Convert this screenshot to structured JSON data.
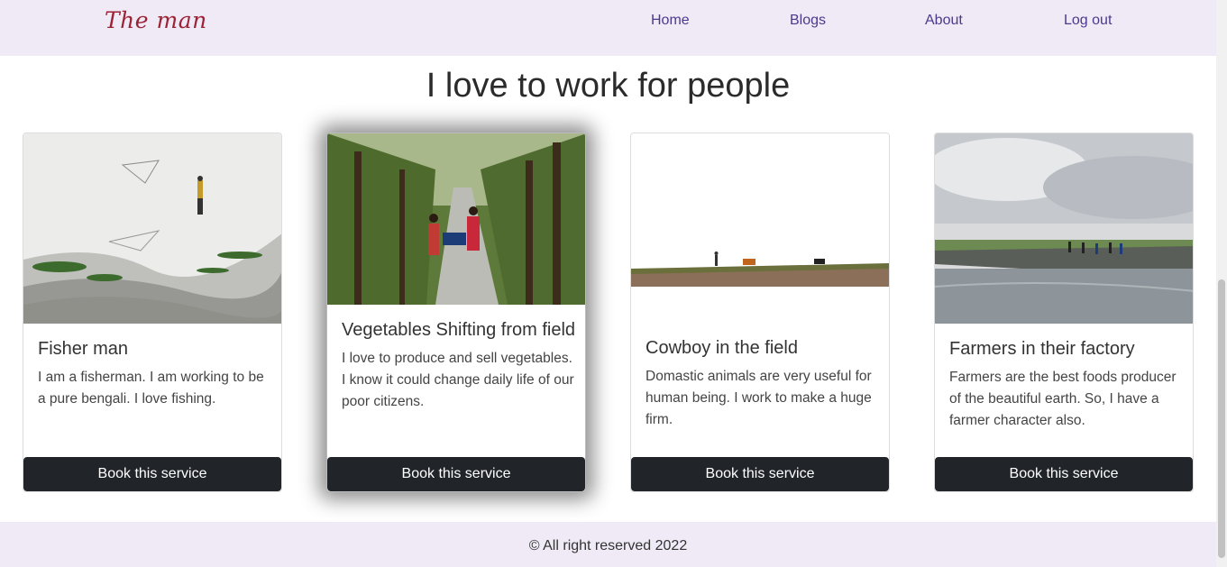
{
  "navbar": {
    "brand": "The man",
    "links": [
      "Home",
      "Blogs",
      "About",
      "Log out"
    ]
  },
  "main": {
    "title": "I love to work for people"
  },
  "cards": [
    {
      "title": "Fisher man",
      "text": "I am a fisherman. I am working to be a pure bengali. I love fishing.",
      "button": "Book this service"
    },
    {
      "title": "Vegetables Shifting from field",
      "text": "I love to produce and sell vegetables. I know it could change daily life of our poor citizens.",
      "button": "Book this service"
    },
    {
      "title": "Cowboy in the field",
      "text": "Domastic animals are very useful for human being. I work to make a huge firm.",
      "button": "Book this service"
    },
    {
      "title": "Farmers in their factory",
      "text": "Farmers are the best foods producer of the beautiful earth. So, I have a farmer character also.",
      "button": "Book this service"
    }
  ],
  "footer": {
    "text": "© All right reserved 2022"
  },
  "colors": {
    "navbar_bg": "#efeaf6",
    "brand": "#9b2335",
    "link": "#4a3a8c",
    "button_bg": "#212529"
  }
}
